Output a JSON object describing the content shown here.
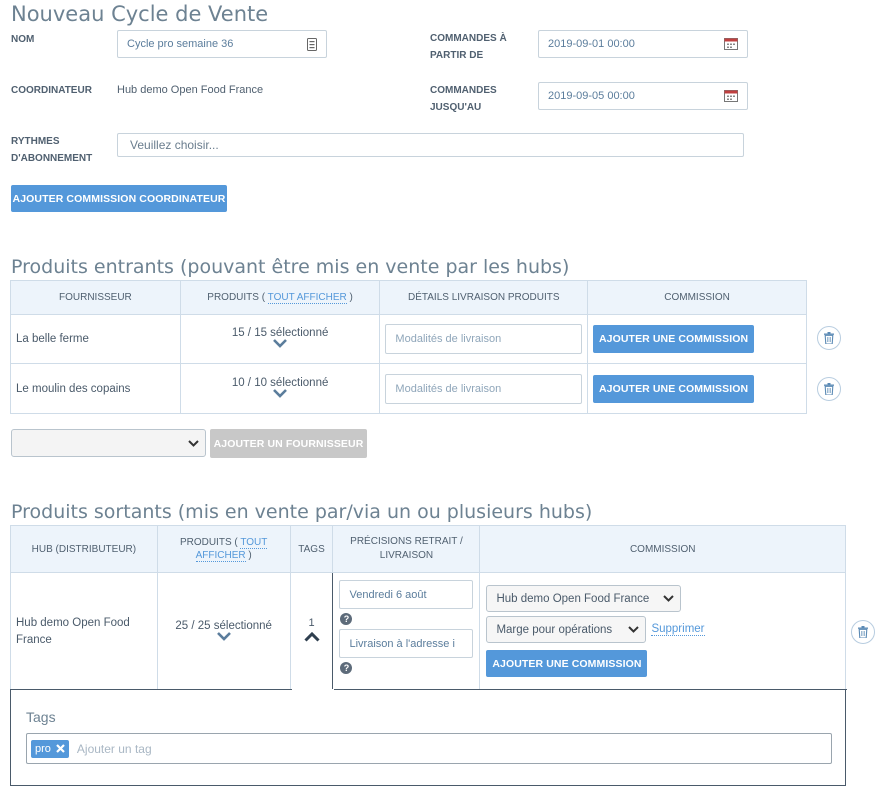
{
  "page": {
    "title": "Nouveau Cycle de Vente"
  },
  "form": {
    "name_label": "NOM",
    "name_value": "Cycle pro semaine 36",
    "coordinator_label": "COORDINATEUR",
    "coordinator_value": "Hub demo Open Food France",
    "orders_open_label_1": "COMMANDES À",
    "orders_open_label_2": "PARTIR DE",
    "orders_open_value": "2019-09-01 00:00",
    "orders_close_label_1": "COMMANDES",
    "orders_close_label_2": "JUSQU'AU",
    "orders_close_value": "2019-09-05 00:00",
    "schedules_label_1": "RYTHMES",
    "schedules_label_2": "D'ABONNEMENT",
    "schedules_placeholder": "Veuillez choisir...",
    "add_coordinator_fee": "AJOUTER COMMISSION COORDINATEUR"
  },
  "incoming": {
    "title": "Produits entrants (pouvant être mis en vente par les hubs)",
    "headers": {
      "supplier": "FOURNISSEUR",
      "products_prefix": "PRODUITS (",
      "products_link": "TOUT AFFICHER",
      "products_suffix": ")",
      "delivery": "DÉTAILS LIVRAISON PRODUITS",
      "fees": "COMMISSION"
    },
    "rows": [
      {
        "supplier": "La belle ferme",
        "selected": "15 / 15 sélectionné",
        "delivery_placeholder": "Modalités de livraison",
        "add_fee": "AJOUTER UNE COMMISSION"
      },
      {
        "supplier": "Le moulin des copains",
        "selected": "10 / 10 sélectionné",
        "delivery_placeholder": "Modalités de livraison",
        "add_fee": "AJOUTER UNE COMMISSION"
      }
    ],
    "add_supplier": "AJOUTER UN FOURNISSEUR"
  },
  "outgoing": {
    "title": "Produits sortants (mis en vente par/via un ou plusieurs hubs)",
    "headers": {
      "hub": "HUB (DISTRIBUTEUR)",
      "products_prefix": "PRODUITS (",
      "products_link_1": "TOUT",
      "products_link_2": "AFFICHER",
      "products_suffix": ")",
      "tags": "TAGS",
      "pickup_1": "PRÉCISIONS RETRAIT /",
      "pickup_2": "LIVRAISON",
      "fees": "COMMISSION"
    },
    "row": {
      "hub_1": "Hub demo Open Food",
      "hub_2": "France",
      "selected": "25 / 25 sélectionné",
      "tag_count": "1",
      "pickup_time": "Vendredi 6 août",
      "pickup_instructions": "Livraison à l'adresse i",
      "fee_enterprise": "Hub demo Open Food France",
      "fee_type": "Marge pour opérations",
      "remove": "Supprimer",
      "add_fee": "AJOUTER UNE COMMISSION"
    },
    "tags_panel": {
      "label": "Tags",
      "tag": "pro",
      "placeholder": "Ajouter un tag"
    }
  },
  "colors": {
    "primary": "#5498da",
    "header_bg": "#edf4fb",
    "title": "#6d8292"
  },
  "icons": [
    "calendar-icon",
    "keyboard-icon",
    "chevron-down-icon",
    "chevron-up-icon",
    "trash-icon",
    "question-icon",
    "close-icon"
  ]
}
